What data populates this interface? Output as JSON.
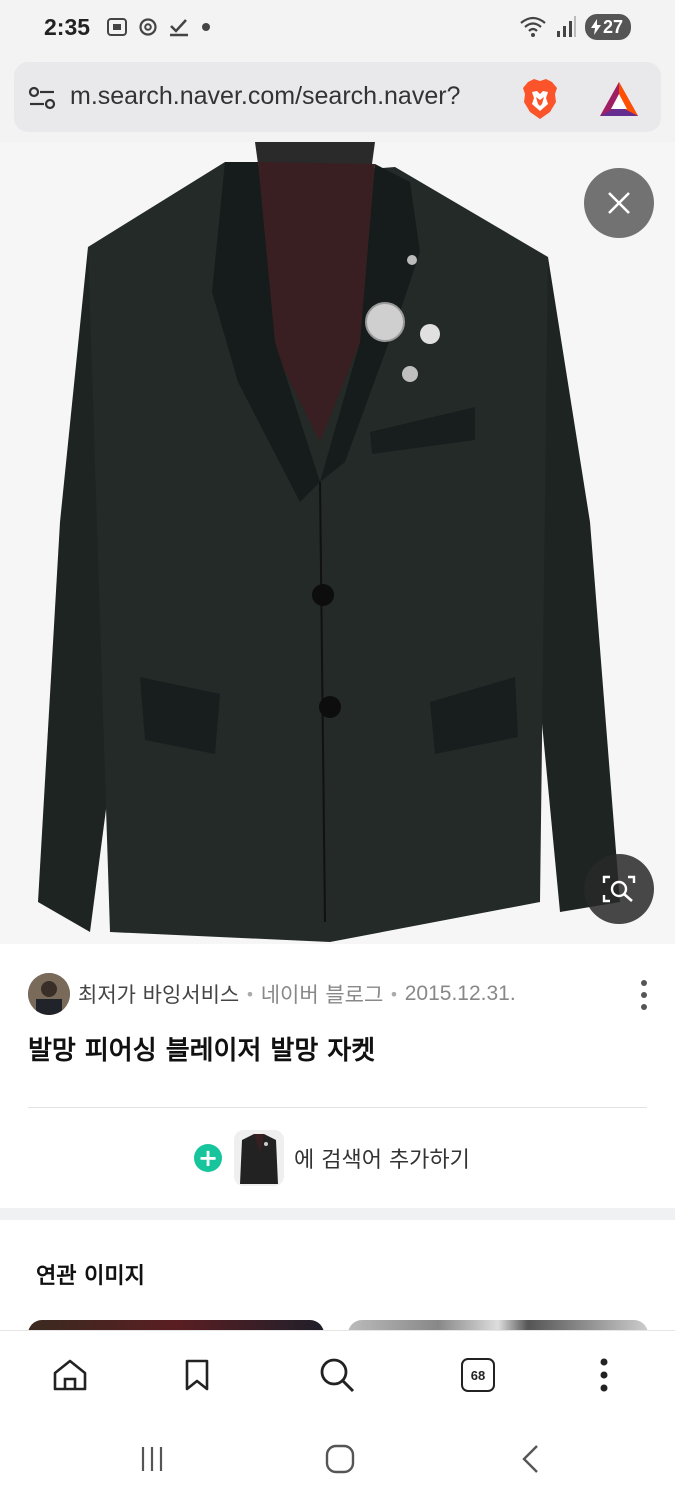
{
  "status_bar": {
    "time": "2:35",
    "left_icons": [
      "screenshot-icon",
      "threads-icon",
      "check-icon",
      "dot-icon"
    ],
    "right_icons": [
      "wifi-icon",
      "signal-icon"
    ],
    "battery": "27"
  },
  "url_bar": {
    "url": "m.search.naver.com/search.naver?"
  },
  "result": {
    "author": "최저가 바잉서비스",
    "source": "네이버 블로그",
    "date": "2015.12.31.",
    "title": "발망 피어싱 블레이저 발망 자켓",
    "add_to_search_label": "에 검색어 추가하기"
  },
  "related": {
    "title": "연관 이미지"
  },
  "bottom_toolbar": {
    "tab_count": "68"
  },
  "colors": {
    "accent_green": "#16c59b",
    "brave_orange": "#fb542b"
  }
}
